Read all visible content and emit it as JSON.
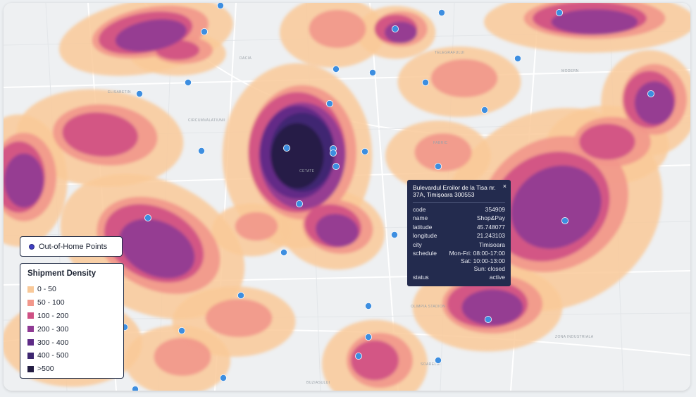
{
  "map": {
    "street_labels": [
      "DACIA",
      "TELEGRAFULUI",
      "MODERN",
      "CIRCUMVALATIUNII",
      "FABRIC",
      "ELISABETIN",
      "CETATE",
      "ZONA INDUSTRIALA",
      "OLIMPIA STADION",
      "SOARELUI",
      "BUZIASULUI"
    ],
    "point_color": "#3d8ee0",
    "density_colors": [
      "#f9c999",
      "#f2978b",
      "#cf5084",
      "#8f3a94",
      "#5d2a86",
      "#3d2670",
      "#241d43"
    ]
  },
  "legend_points": {
    "label": "Out-of-Home Points"
  },
  "legend_density": {
    "title": "Shipment Density",
    "bins": [
      {
        "label": "0 - 50",
        "color": "#f9c999"
      },
      {
        "label": "50 - 100",
        "color": "#f2978b"
      },
      {
        "label": "100 - 200",
        "color": "#cf5084"
      },
      {
        "label": "200 - 300",
        "color": "#8f3a94"
      },
      {
        "label": "300 - 400",
        "color": "#5d2a86"
      },
      {
        "label": "400 - 500",
        "color": "#3d2670"
      },
      {
        "label": ">500",
        "color": "#241d43"
      }
    ]
  },
  "tooltip": {
    "close": "×",
    "address": "Bulevardul Eroilor de la Tisa nr. 37A, Timișoara 300553",
    "fields": [
      {
        "key": "code",
        "value": "354909"
      },
      {
        "key": "name",
        "value": "Shop&Pay"
      },
      {
        "key": "latitude",
        "value": "45.748077"
      },
      {
        "key": "longitude",
        "value": "21.243103"
      },
      {
        "key": "city",
        "value": "Timisoara"
      },
      {
        "key": "schedule",
        "value": "Mon-Fri: 08:00-17:00\nSat: 10:00-13:00\nSun: closed"
      },
      {
        "key": "status",
        "value": "active"
      }
    ]
  }
}
